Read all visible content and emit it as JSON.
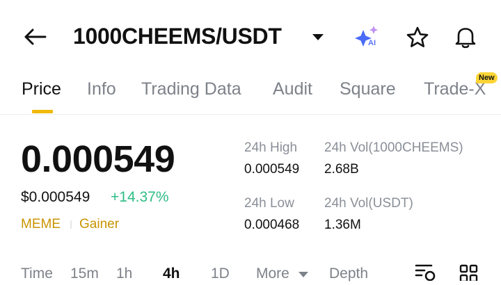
{
  "header": {
    "title": "1000CHEEMS/USDT",
    "back_icon": "arrow-left-icon",
    "title_dropdown_icon": "caret-down-icon",
    "ai_icon": "ai-sparkle-icon",
    "ai_label": "AI",
    "favorite_icon": "star-icon",
    "alert_icon": "bell-icon"
  },
  "tabs": [
    {
      "label": "Price",
      "active": true
    },
    {
      "label": "Info"
    },
    {
      "label": "Trading Data"
    },
    {
      "label": "Audit"
    },
    {
      "label": "Square"
    },
    {
      "label": "Trade-X",
      "badge": "New"
    }
  ],
  "price": {
    "last": "0.000549",
    "fiat": "$0.000549",
    "change": "+14.37%",
    "tags": [
      "MEME",
      "Gainer"
    ]
  },
  "stats": {
    "high_label": "24h High",
    "high_value": "0.000549",
    "vol_base_label": "24h Vol(1000CHEEMS)",
    "vol_base_value": "2.68B",
    "low_label": "24h Low",
    "low_value": "0.000468",
    "vol_quote_label": "24h Vol(USDT)",
    "vol_quote_value": "1.36M"
  },
  "intervals": {
    "items": [
      "Time",
      "15m",
      "1h",
      "4h",
      "1D",
      "More"
    ],
    "active": "4h",
    "depth_label": "Depth",
    "more_icon": "caret-down-icon",
    "settings_icon": "chart-settings-icon",
    "layout_icon": "grid-icon"
  },
  "colors": {
    "accent": "#f0b90b",
    "up": "#2ebd85",
    "tag": "#c99400",
    "muted": "#8a8f98"
  }
}
